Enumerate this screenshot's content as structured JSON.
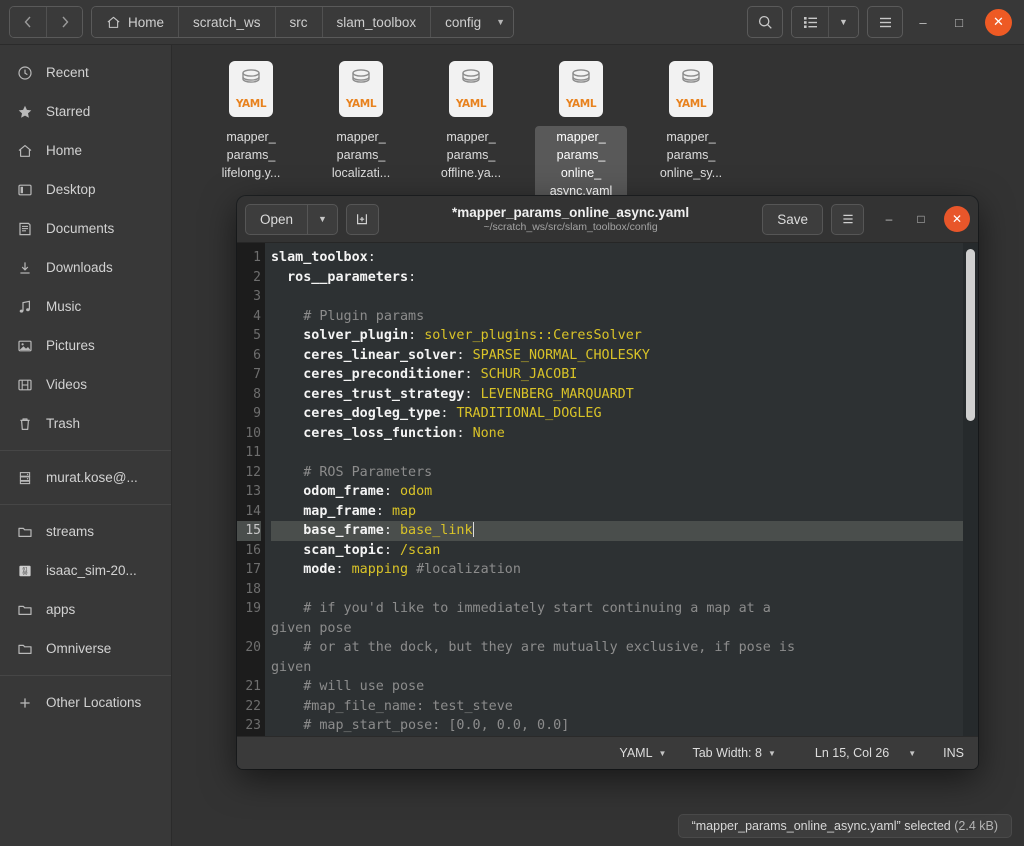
{
  "file_manager": {
    "nav": {
      "back_icon": "chevron-left-icon",
      "forward_icon": "chevron-right-icon"
    },
    "breadcrumbs": [
      {
        "label": "Home",
        "icon": "home-icon"
      },
      {
        "label": "scratch_ws",
        "icon": ""
      },
      {
        "label": "src",
        "icon": ""
      },
      {
        "label": "slam_toolbox",
        "icon": ""
      },
      {
        "label": "config",
        "icon": ""
      }
    ],
    "breadcrumb_caret": "▼",
    "toolbar": {
      "search_icon": "search-icon",
      "view_list_icon": "list-view-icon",
      "view_caret": "▼",
      "menu_icon": "hamburger-menu-icon"
    },
    "window_controls": {
      "minimize": "–",
      "maximize": "□",
      "close": "✕"
    },
    "sidebar": {
      "items": [
        {
          "label": "Recent",
          "icon": "clock-icon"
        },
        {
          "label": "Starred",
          "icon": "star-icon"
        },
        {
          "label": "Home",
          "icon": "home-icon"
        },
        {
          "label": "Desktop",
          "icon": "desktop-icon"
        },
        {
          "label": "Documents",
          "icon": "documents-icon"
        },
        {
          "label": "Downloads",
          "icon": "download-icon"
        },
        {
          "label": "Music",
          "icon": "music-note-icon"
        },
        {
          "label": "Pictures",
          "icon": "picture-icon"
        },
        {
          "label": "Videos",
          "icon": "video-icon"
        },
        {
          "label": "Trash",
          "icon": "trash-icon"
        }
      ],
      "devices": [
        {
          "label": "murat.kose@...",
          "icon": "server-icon"
        }
      ],
      "bookmarks": [
        {
          "label": "streams",
          "icon": "folder-icon"
        },
        {
          "label": "isaac_sim-20...",
          "icon": "binary-drive-icon"
        },
        {
          "label": "apps",
          "icon": "folder-icon"
        },
        {
          "label": "Omniverse",
          "icon": "folder-icon"
        }
      ],
      "other": {
        "label": "Other Locations",
        "icon": "plus-icon"
      }
    },
    "files": [
      {
        "name": "mapper_\nparams_\nlifelong.y...",
        "type": "YAML",
        "selected": false
      },
      {
        "name": "mapper_\nparams_\nlocalizati...",
        "type": "YAML",
        "selected": false
      },
      {
        "name": "mapper_\nparams_\noffline.ya...",
        "type": "YAML",
        "selected": false
      },
      {
        "name": "mapper_\nparams_\nonline_\nasync.yaml",
        "type": "YAML",
        "selected": true
      },
      {
        "name": "mapper_\nparams_\nonline_sy...",
        "type": "YAML",
        "selected": false
      }
    ],
    "status": {
      "text": "“mapper_params_online_async.yaml” selected",
      "size": "(2.4 kB)"
    }
  },
  "editor": {
    "open_label": "Open",
    "open_caret": "▼",
    "new_tab_icon": "new-document-icon",
    "title": "*mapper_params_online_async.yaml",
    "subtitle": "~/scratch_ws/src/slam_toolbox/config",
    "save_label": "Save",
    "menu_icon": "hamburger-menu-icon",
    "window_controls": {
      "minimize": "–",
      "maximize": "□",
      "close": "✕"
    },
    "statusbar": {
      "language": "YAML",
      "tab_width": "Tab Width: 8",
      "position": "Ln 15, Col 26",
      "insert_mode": "INS",
      "caret": "▼"
    },
    "lines": [
      {
        "n": 1,
        "segs": [
          {
            "t": "k",
            "s": "slam_toolbox"
          },
          {
            "t": "p",
            "s": ":"
          }
        ]
      },
      {
        "n": 2,
        "segs": [
          {
            "t": "k",
            "s": "  ros__parameters"
          },
          {
            "t": "p",
            "s": ":"
          }
        ]
      },
      {
        "n": 3,
        "segs": []
      },
      {
        "n": 4,
        "segs": [
          {
            "t": "c",
            "s": "    # Plugin params"
          }
        ]
      },
      {
        "n": 5,
        "segs": [
          {
            "t": "k",
            "s": "    solver_plugin"
          },
          {
            "t": "p",
            "s": ": "
          },
          {
            "t": "v",
            "s": "solver_plugins::CeresSolver"
          }
        ]
      },
      {
        "n": 6,
        "segs": [
          {
            "t": "k",
            "s": "    ceres_linear_solver"
          },
          {
            "t": "p",
            "s": ": "
          },
          {
            "t": "v",
            "s": "SPARSE_NORMAL_CHOLESKY"
          }
        ]
      },
      {
        "n": 7,
        "segs": [
          {
            "t": "k",
            "s": "    ceres_preconditioner"
          },
          {
            "t": "p",
            "s": ": "
          },
          {
            "t": "v",
            "s": "SCHUR_JACOBI"
          }
        ]
      },
      {
        "n": 8,
        "segs": [
          {
            "t": "k",
            "s": "    ceres_trust_strategy"
          },
          {
            "t": "p",
            "s": ": "
          },
          {
            "t": "v",
            "s": "LEVENBERG_MARQUARDT"
          }
        ]
      },
      {
        "n": 9,
        "segs": [
          {
            "t": "k",
            "s": "    ceres_dogleg_type"
          },
          {
            "t": "p",
            "s": ": "
          },
          {
            "t": "v",
            "s": "TRADITIONAL_DOGLEG"
          }
        ]
      },
      {
        "n": 10,
        "segs": [
          {
            "t": "k",
            "s": "    ceres_loss_function"
          },
          {
            "t": "p",
            "s": ": "
          },
          {
            "t": "v",
            "s": "None"
          }
        ]
      },
      {
        "n": 11,
        "segs": []
      },
      {
        "n": 12,
        "segs": [
          {
            "t": "c",
            "s": "    # ROS Parameters"
          }
        ]
      },
      {
        "n": 13,
        "segs": [
          {
            "t": "k",
            "s": "    odom_frame"
          },
          {
            "t": "p",
            "s": ": "
          },
          {
            "t": "v",
            "s": "odom"
          }
        ]
      },
      {
        "n": 14,
        "segs": [
          {
            "t": "k",
            "s": "    map_frame"
          },
          {
            "t": "p",
            "s": ": "
          },
          {
            "t": "v",
            "s": "map"
          }
        ]
      },
      {
        "n": 15,
        "segs": [
          {
            "t": "k",
            "s": "    base_frame"
          },
          {
            "t": "p",
            "s": ": "
          },
          {
            "t": "v",
            "s": "base_link"
          },
          {
            "t": "caret",
            "s": ""
          }
        ],
        "current": true
      },
      {
        "n": 16,
        "segs": [
          {
            "t": "k",
            "s": "    scan_topic"
          },
          {
            "t": "p",
            "s": ": "
          },
          {
            "t": "v",
            "s": "/scan"
          }
        ]
      },
      {
        "n": 17,
        "segs": [
          {
            "t": "k",
            "s": "    mode"
          },
          {
            "t": "p",
            "s": ": "
          },
          {
            "t": "v",
            "s": "mapping"
          },
          {
            "t": "c",
            "s": " #localization"
          }
        ]
      },
      {
        "n": 18,
        "segs": []
      },
      {
        "n": 19,
        "segs": [
          {
            "t": "c",
            "s": "    # if you'd like to immediately start continuing a map at a"
          }
        ]
      },
      {
        "n": "",
        "segs": [
          {
            "t": "c",
            "s": "given pose"
          }
        ]
      },
      {
        "n": 20,
        "segs": [
          {
            "t": "c",
            "s": "    # or at the dock, but they are mutually exclusive, if pose is"
          }
        ]
      },
      {
        "n": "",
        "segs": [
          {
            "t": "c",
            "s": "given"
          }
        ]
      },
      {
        "n": 21,
        "segs": [
          {
            "t": "c",
            "s": "    # will use pose"
          }
        ]
      },
      {
        "n": 22,
        "segs": [
          {
            "t": "c",
            "s": "    #map_file_name: test_steve"
          }
        ]
      },
      {
        "n": 23,
        "segs": [
          {
            "t": "c",
            "s": "    # map_start_pose: [0.0, 0.0, 0.0]"
          }
        ]
      }
    ]
  },
  "colors": {
    "accent_close": "#e8562a",
    "yaml_orange": "#e8821e",
    "code_value": "#d9c328",
    "code_comment": "#8c8c8c",
    "editor_bg": "#2d3133",
    "gutter_bg": "#1c1c1c",
    "current_line": "#4a4e4c"
  }
}
